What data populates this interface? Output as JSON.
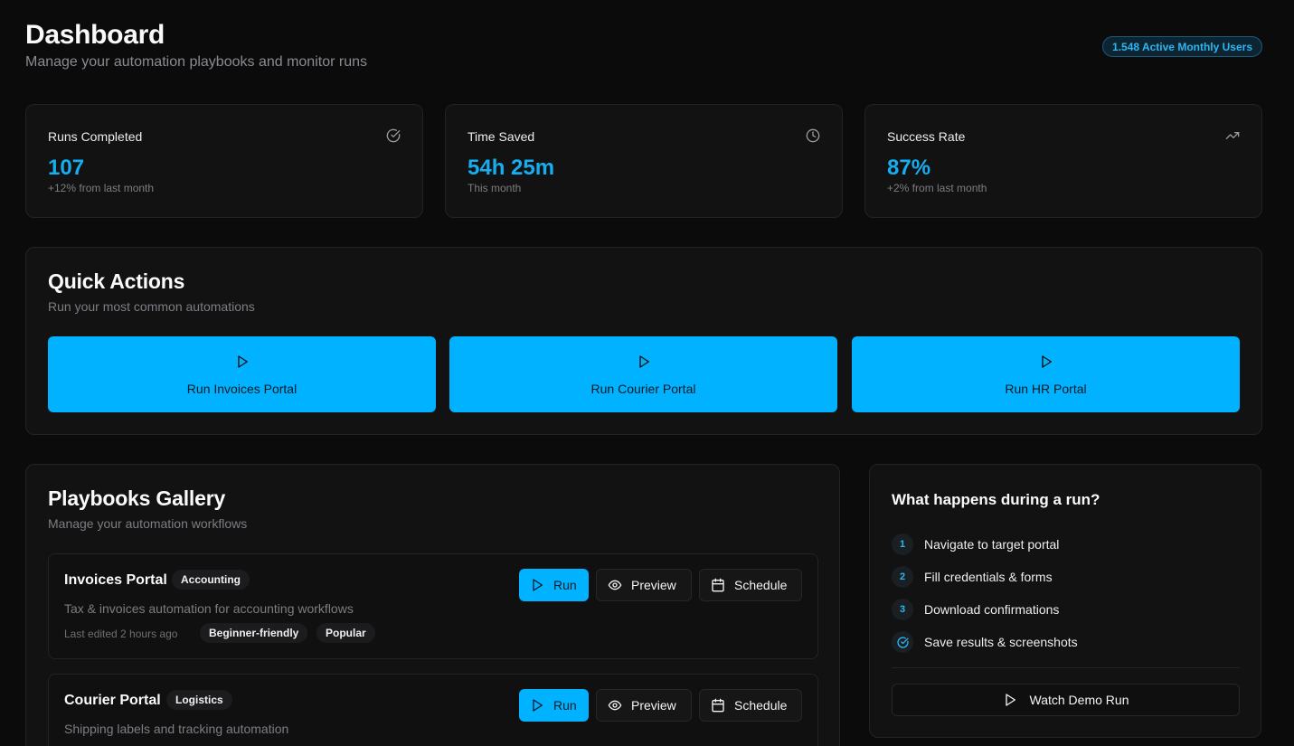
{
  "header": {
    "title": "Dashboard",
    "subtitle": "Manage your automation playbooks and monitor runs",
    "users_badge": "1.548 Active Monthly Users"
  },
  "stats": [
    {
      "label": "Runs Completed",
      "value": "107",
      "sub": "+12% from last month",
      "icon": "check-circle-icon"
    },
    {
      "label": "Time Saved",
      "value": "54h 25m",
      "sub": "This month",
      "icon": "clock-icon"
    },
    {
      "label": "Success Rate",
      "value": "87%",
      "sub": "+2% from last month",
      "icon": "trending-up-icon"
    }
  ],
  "quick_actions": {
    "title": "Quick Actions",
    "subtitle": "Run your most common automations",
    "buttons": [
      {
        "label": "Run Invoices Portal"
      },
      {
        "label": "Run Courier Portal"
      },
      {
        "label": "Run HR Portal"
      }
    ]
  },
  "gallery": {
    "title": "Playbooks Gallery",
    "subtitle": "Manage your automation workflows",
    "items": [
      {
        "name": "Invoices Portal",
        "category": "Accounting",
        "description": "Tax & invoices automation for accounting workflows",
        "edited": "Last edited 2 hours ago",
        "tags": [
          "Beginner-friendly",
          "Popular"
        ]
      },
      {
        "name": "Courier Portal",
        "category": "Logistics",
        "description": "Shipping labels and tracking automation",
        "edited": "",
        "tags": []
      }
    ],
    "actions": {
      "run": "Run",
      "preview": "Preview",
      "schedule": "Schedule"
    }
  },
  "run_steps": {
    "title": "What happens during a run?",
    "steps": [
      {
        "num": "1",
        "text": "Navigate to target portal"
      },
      {
        "num": "2",
        "text": "Fill credentials & forms"
      },
      {
        "num": "3",
        "text": "Download confirmations"
      },
      {
        "num": "",
        "text": "Save results & screenshots",
        "icon": "check-circle-icon"
      }
    ],
    "demo_button": "Watch Demo Run"
  },
  "colors": {
    "background": "#0b0b0c",
    "card": "#121213",
    "accent": "#00b2ff",
    "accent_text": "#16aef0",
    "muted_text": "#7d7d83"
  }
}
